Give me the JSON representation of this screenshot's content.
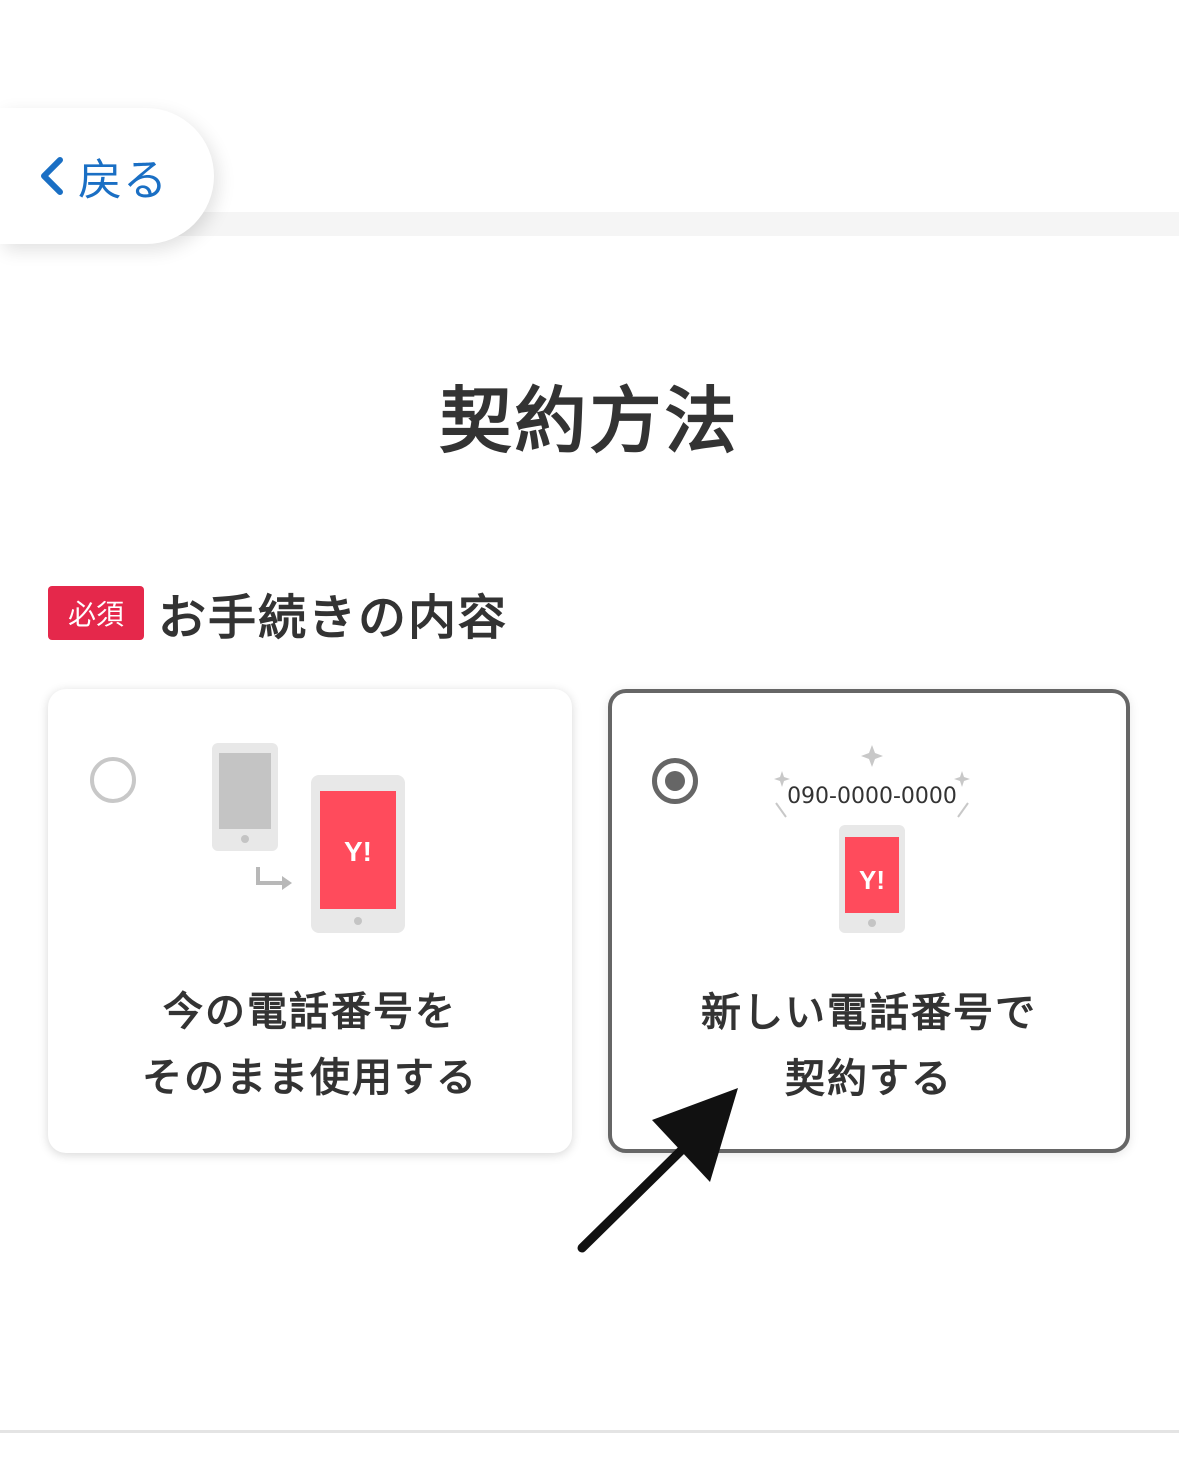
{
  "nav": {
    "back_label": "戻る"
  },
  "page": {
    "title": "契約方法"
  },
  "section": {
    "badge": "必須",
    "title": "お手続きの内容"
  },
  "options": [
    {
      "line1": "今の電話番号を",
      "line2": "そのまま使用する",
      "selected": false,
      "phone_logo": "Y!"
    },
    {
      "line1": "新しい電話番号で",
      "line2": "契約する",
      "selected": true,
      "phone_logo": "Y!",
      "number_text": "090-0000-0000"
    }
  ],
  "colors": {
    "accent_blue": "#1a6fc4",
    "required_red": "#e5284b",
    "phone_red": "#ff4b5c",
    "selected_border": "#666666"
  },
  "icons": {
    "back": "chevron-left-icon",
    "annotation": "arrow-icon"
  }
}
